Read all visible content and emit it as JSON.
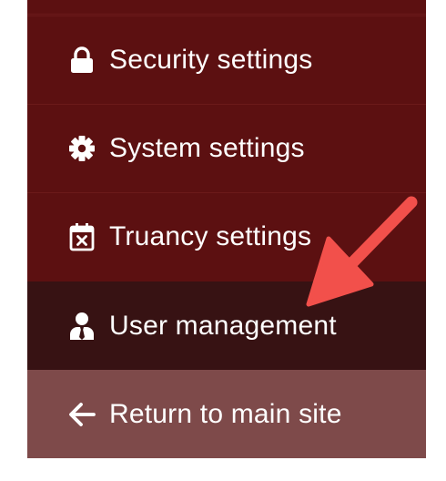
{
  "sidebar": {
    "items": [
      {
        "label": "Security settings",
        "icon": "lock-icon"
      },
      {
        "label": "System settings",
        "icon": "gear-icon"
      },
      {
        "label": "Truancy settings",
        "icon": "calendar-x-icon"
      },
      {
        "label": "User management",
        "icon": "user-tie-icon",
        "active": true
      },
      {
        "label": "Return to main site",
        "icon": "arrow-left-icon"
      }
    ]
  },
  "annotation": {
    "icon": "callout-arrow-icon",
    "color": "#f2504b"
  },
  "colors": {
    "sidebar_bg": "#5c1011",
    "active_bg": "#371213",
    "return_bg": "#7e4a4a",
    "text": "#ffffff"
  }
}
